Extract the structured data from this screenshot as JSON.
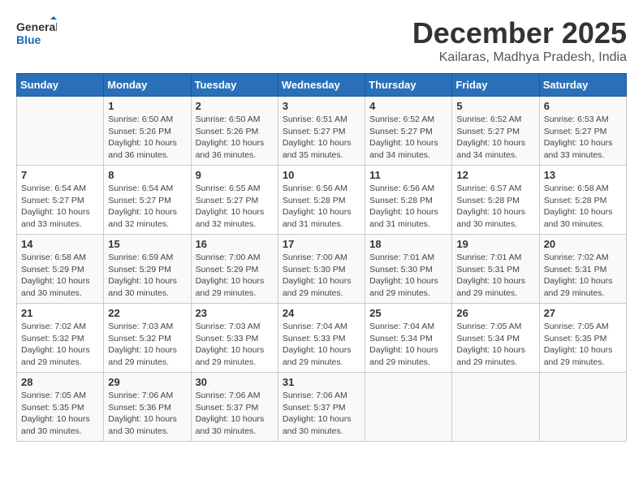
{
  "logo": {
    "line1": "General",
    "line2": "Blue"
  },
  "title": "December 2025",
  "location": "Kailaras, Madhya Pradesh, India",
  "weekdays": [
    "Sunday",
    "Monday",
    "Tuesday",
    "Wednesday",
    "Thursday",
    "Friday",
    "Saturday"
  ],
  "weeks": [
    [
      {
        "day": "",
        "info": ""
      },
      {
        "day": "1",
        "info": "Sunrise: 6:50 AM\nSunset: 5:26 PM\nDaylight: 10 hours\nand 36 minutes."
      },
      {
        "day": "2",
        "info": "Sunrise: 6:50 AM\nSunset: 5:26 PM\nDaylight: 10 hours\nand 36 minutes."
      },
      {
        "day": "3",
        "info": "Sunrise: 6:51 AM\nSunset: 5:27 PM\nDaylight: 10 hours\nand 35 minutes."
      },
      {
        "day": "4",
        "info": "Sunrise: 6:52 AM\nSunset: 5:27 PM\nDaylight: 10 hours\nand 34 minutes."
      },
      {
        "day": "5",
        "info": "Sunrise: 6:52 AM\nSunset: 5:27 PM\nDaylight: 10 hours\nand 34 minutes."
      },
      {
        "day": "6",
        "info": "Sunrise: 6:53 AM\nSunset: 5:27 PM\nDaylight: 10 hours\nand 33 minutes."
      }
    ],
    [
      {
        "day": "7",
        "info": "Sunrise: 6:54 AM\nSunset: 5:27 PM\nDaylight: 10 hours\nand 33 minutes."
      },
      {
        "day": "8",
        "info": "Sunrise: 6:54 AM\nSunset: 5:27 PM\nDaylight: 10 hours\nand 32 minutes."
      },
      {
        "day": "9",
        "info": "Sunrise: 6:55 AM\nSunset: 5:27 PM\nDaylight: 10 hours\nand 32 minutes."
      },
      {
        "day": "10",
        "info": "Sunrise: 6:56 AM\nSunset: 5:28 PM\nDaylight: 10 hours\nand 31 minutes."
      },
      {
        "day": "11",
        "info": "Sunrise: 6:56 AM\nSunset: 5:28 PM\nDaylight: 10 hours\nand 31 minutes."
      },
      {
        "day": "12",
        "info": "Sunrise: 6:57 AM\nSunset: 5:28 PM\nDaylight: 10 hours\nand 30 minutes."
      },
      {
        "day": "13",
        "info": "Sunrise: 6:58 AM\nSunset: 5:28 PM\nDaylight: 10 hours\nand 30 minutes."
      }
    ],
    [
      {
        "day": "14",
        "info": "Sunrise: 6:58 AM\nSunset: 5:29 PM\nDaylight: 10 hours\nand 30 minutes."
      },
      {
        "day": "15",
        "info": "Sunrise: 6:59 AM\nSunset: 5:29 PM\nDaylight: 10 hours\nand 30 minutes."
      },
      {
        "day": "16",
        "info": "Sunrise: 7:00 AM\nSunset: 5:29 PM\nDaylight: 10 hours\nand 29 minutes."
      },
      {
        "day": "17",
        "info": "Sunrise: 7:00 AM\nSunset: 5:30 PM\nDaylight: 10 hours\nand 29 minutes."
      },
      {
        "day": "18",
        "info": "Sunrise: 7:01 AM\nSunset: 5:30 PM\nDaylight: 10 hours\nand 29 minutes."
      },
      {
        "day": "19",
        "info": "Sunrise: 7:01 AM\nSunset: 5:31 PM\nDaylight: 10 hours\nand 29 minutes."
      },
      {
        "day": "20",
        "info": "Sunrise: 7:02 AM\nSunset: 5:31 PM\nDaylight: 10 hours\nand 29 minutes."
      }
    ],
    [
      {
        "day": "21",
        "info": "Sunrise: 7:02 AM\nSunset: 5:32 PM\nDaylight: 10 hours\nand 29 minutes."
      },
      {
        "day": "22",
        "info": "Sunrise: 7:03 AM\nSunset: 5:32 PM\nDaylight: 10 hours\nand 29 minutes."
      },
      {
        "day": "23",
        "info": "Sunrise: 7:03 AM\nSunset: 5:33 PM\nDaylight: 10 hours\nand 29 minutes."
      },
      {
        "day": "24",
        "info": "Sunrise: 7:04 AM\nSunset: 5:33 PM\nDaylight: 10 hours\nand 29 minutes."
      },
      {
        "day": "25",
        "info": "Sunrise: 7:04 AM\nSunset: 5:34 PM\nDaylight: 10 hours\nand 29 minutes."
      },
      {
        "day": "26",
        "info": "Sunrise: 7:05 AM\nSunset: 5:34 PM\nDaylight: 10 hours\nand 29 minutes."
      },
      {
        "day": "27",
        "info": "Sunrise: 7:05 AM\nSunset: 5:35 PM\nDaylight: 10 hours\nand 29 minutes."
      }
    ],
    [
      {
        "day": "28",
        "info": "Sunrise: 7:05 AM\nSunset: 5:35 PM\nDaylight: 10 hours\nand 30 minutes."
      },
      {
        "day": "29",
        "info": "Sunrise: 7:06 AM\nSunset: 5:36 PM\nDaylight: 10 hours\nand 30 minutes."
      },
      {
        "day": "30",
        "info": "Sunrise: 7:06 AM\nSunset: 5:37 PM\nDaylight: 10 hours\nand 30 minutes."
      },
      {
        "day": "31",
        "info": "Sunrise: 7:06 AM\nSunset: 5:37 PM\nDaylight: 10 hours\nand 30 minutes."
      },
      {
        "day": "",
        "info": ""
      },
      {
        "day": "",
        "info": ""
      },
      {
        "day": "",
        "info": ""
      }
    ]
  ]
}
